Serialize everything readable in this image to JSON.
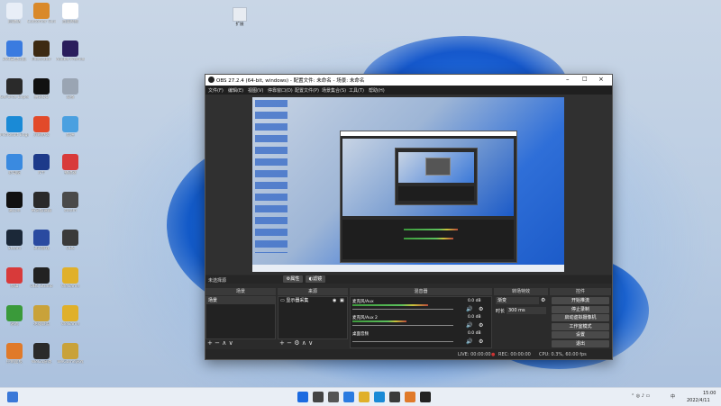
{
  "desktop": {
    "icons": [
      {
        "label": "回收站",
        "color": "#e8eef7"
      },
      {
        "label": "Customer Guide",
        "color": "#d9892a"
      },
      {
        "label": "百度网盘",
        "color": "#ffffff"
      },
      {
        "label": "360安全浏览",
        "color": "#3a7be0"
      },
      {
        "label": "Illustrator",
        "color": "#3d2a12"
      },
      {
        "label": "Adobe Premiere",
        "color": "#2a1d5c"
      },
      {
        "label": "GeForce Experience",
        "color": "#2a2a2a"
      },
      {
        "label": "腾讯QQ",
        "color": "#111111"
      },
      {
        "label": "设备",
        "color": "#9aa5b3"
      },
      {
        "label": "Microsoft Edge",
        "color": "#1a8ad6"
      },
      {
        "label": "万彩办公",
        "color": "#e24a2a"
      },
      {
        "label": "剪映",
        "color": "#4aa0e0"
      },
      {
        "label": "此电脑",
        "color": "#3a8ae0"
      },
      {
        "label": "N卡",
        "color": "#1d3a8a"
      },
      {
        "label": "播放器",
        "color": "#d83a3a"
      },
      {
        "label": "蒲公英",
        "color": "#111111"
      },
      {
        "label": "奇游加速器",
        "color": "#2a2a2a"
      },
      {
        "label": "steam",
        "color": "#4a4a4a"
      },
      {
        "label": "Steam",
        "color": "#1b2838"
      },
      {
        "label": "360游戏",
        "color": "#2a4aa0"
      },
      {
        "label": "OBS",
        "color": "#3a3a3a"
      },
      {
        "label": "剪辑",
        "color": "#d83a3a"
      },
      {
        "label": "OBS Studio",
        "color": "#222222"
      },
      {
        "label": "WeGame",
        "color": "#e0b02a"
      },
      {
        "label": "游戏",
        "color": "#3a9a3a"
      },
      {
        "label": "英雄联盟",
        "color": "#c9a23a"
      },
      {
        "label": "WeGame",
        "color": "#e0b02a"
      },
      {
        "label": "控制面板",
        "color": "#e07a2a"
      },
      {
        "label": "WeGa游戏",
        "color": "#2a2a2a"
      },
      {
        "label": "WeGame游戏",
        "color": "#c9a23a"
      }
    ],
    "top_file_label": "扩展"
  },
  "obs": {
    "title": "OBS 27.2.4 (64-bit, windows) - 配置文件: 未命名 - 场景: 未命名",
    "menu": [
      "文件(F)",
      "编辑(E)",
      "视图(V)",
      "停靠窗口(D)",
      "配置文件(P)",
      "场景集合(S)",
      "工具(T)",
      "帮助(H)"
    ],
    "no_source_label": "未选择源",
    "prop_button": "属性",
    "filter_button": "滤镜",
    "docks": {
      "scenes": "场景",
      "sources": "来源",
      "mixer": "混音器",
      "transitions": "转场特效",
      "controls": "控件"
    },
    "scene_item": "场景",
    "source_item": "显示器采集",
    "mixer": [
      {
        "name": "麦克风/Aux",
        "db": "0.0 dB",
        "level": 0.7
      },
      {
        "name": "麦克风/Aux 2",
        "db": "0.0 dB",
        "level": 0.5
      },
      {
        "name": "桌面音频",
        "db": "0.0 dB",
        "level": 0.0
      }
    ],
    "transition_select": "渐变",
    "duration_label": "时长",
    "duration_value": "300 ms",
    "controls": [
      "开始推流",
      "停止录制",
      "启动虚拟摄像机",
      "工作室模式",
      "设置",
      "退出"
    ],
    "status": {
      "live": "LIVE: 00:00:00",
      "rec": "REC: 00:00:00",
      "cpu": "CPU: 0.3%, 60.00 fps"
    }
  },
  "taskbar": {
    "time": "15:00",
    "date": "2022/4/11",
    "lang": "中",
    "apps": [
      "start-icon",
      "search-icon",
      "task-view-icon",
      "widgets-icon",
      "explorer-icon",
      "edge-icon",
      "store-icon",
      "qq-icon",
      "obs-icon"
    ]
  }
}
